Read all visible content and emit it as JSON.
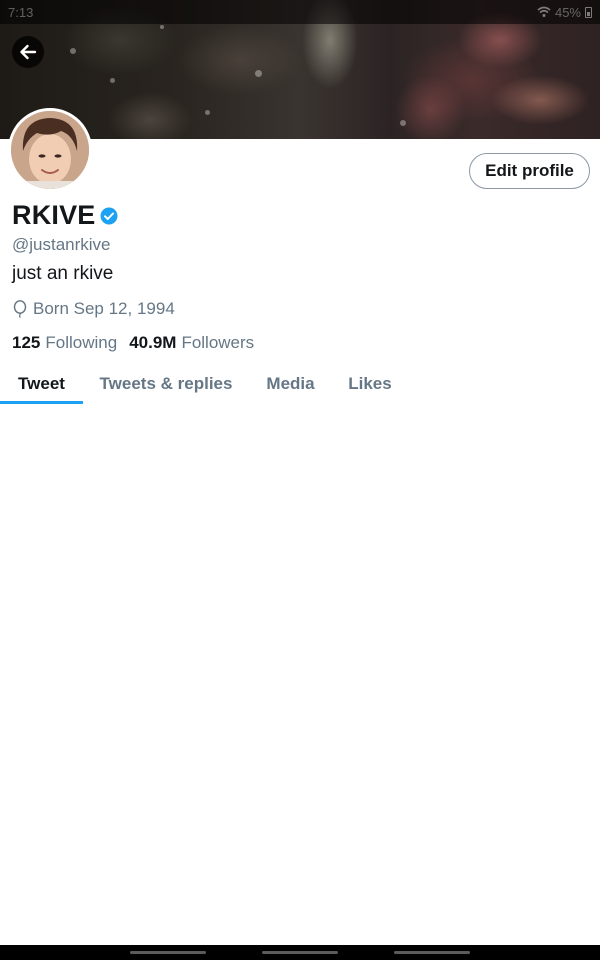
{
  "status_bar": {
    "time": "7:13",
    "battery": "45%"
  },
  "banner_icons": {
    "back": "arrow-left-icon"
  },
  "profile": {
    "name": "RKIVE",
    "verified_icon": "verified-badge-icon",
    "handle": "@justanrkive",
    "bio": "just an rkive",
    "birthday": "Born Sep 12, 1994",
    "birthday_icon": "balloon-icon",
    "following_count": "125",
    "following_label": "Following",
    "followers_count": "40.9M",
    "followers_label": "Followers"
  },
  "actions": {
    "edit_profile": "Edit profile"
  },
  "tabs": [
    {
      "label": "Tweet",
      "active": true
    },
    {
      "label": "Tweets & replies",
      "active": false
    },
    {
      "label": "Media",
      "active": false
    },
    {
      "label": "Likes",
      "active": false
    }
  ],
  "colors": {
    "accent": "#1da1f2",
    "text": "#14171a",
    "secondary": "#657786"
  }
}
